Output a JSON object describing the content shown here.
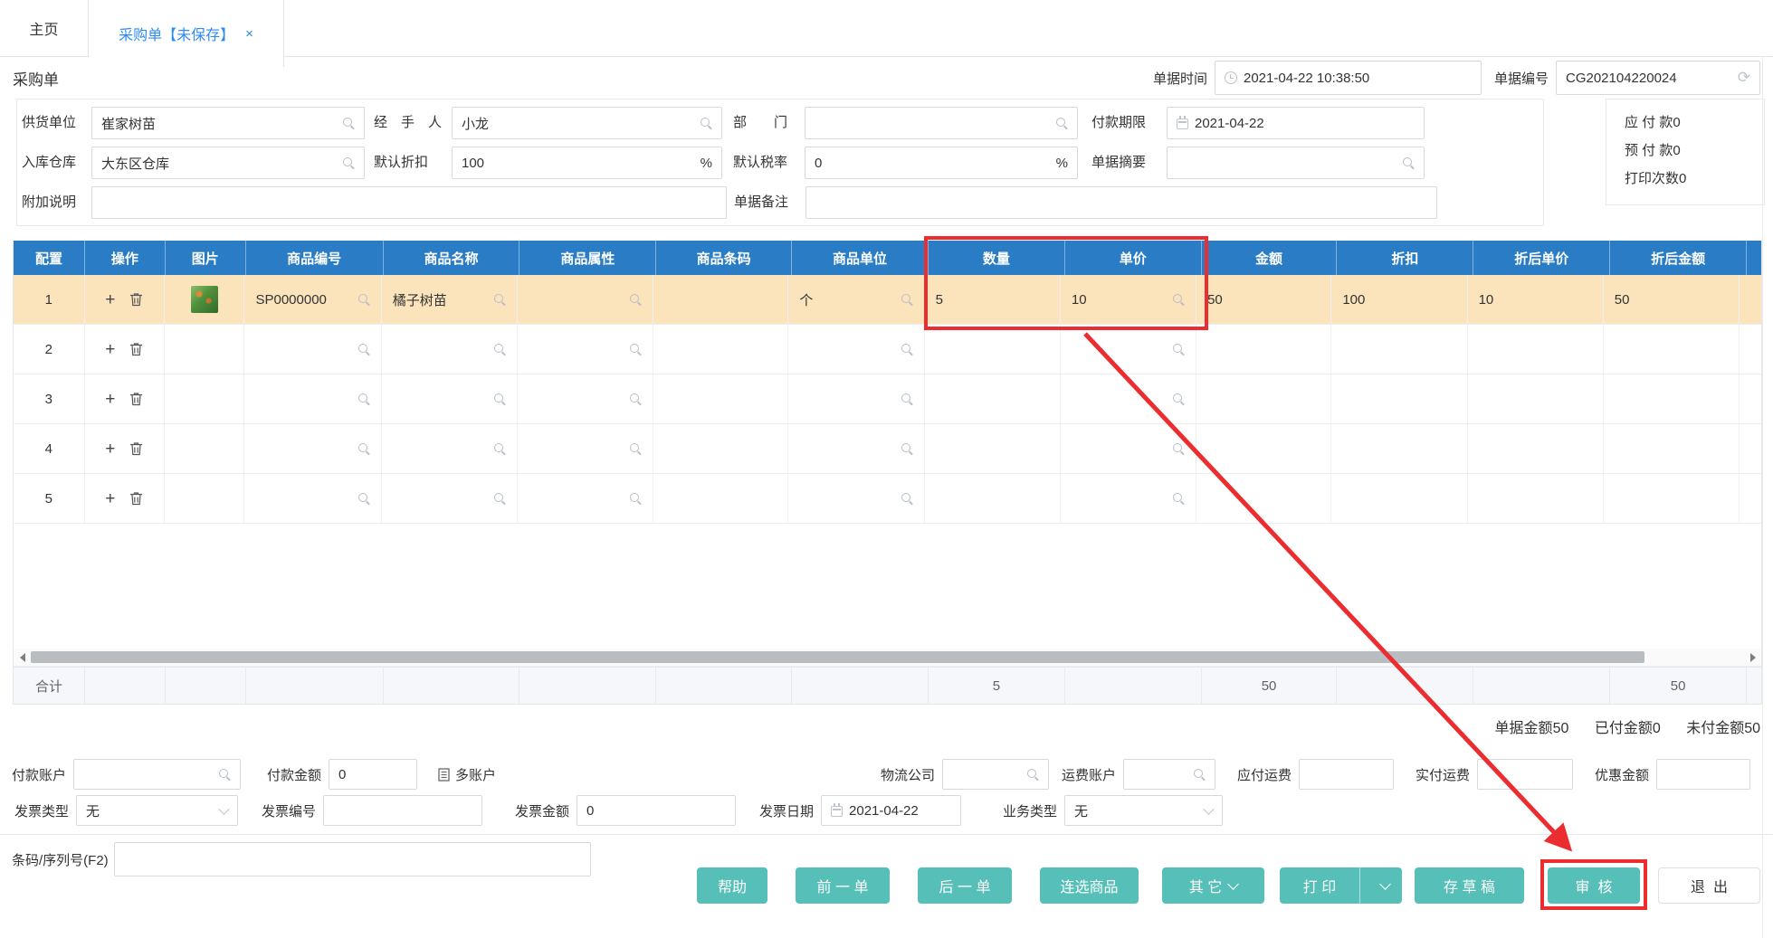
{
  "tabs": {
    "home": "主页",
    "current": "采购单【未保存】"
  },
  "title": "采购单",
  "header_fields": {
    "time_label": "单据时间",
    "time_value": "2021-04-22 10:38:50",
    "no_label": "单据编号",
    "no_value": "CG202104220024"
  },
  "form": {
    "supplier_label": "供货单位",
    "supplier_value": "崔家树苗",
    "handler_label": "经　手　人",
    "handler_value": "小龙",
    "dept_label": "部　　门",
    "dept_value": "",
    "due_label": "付款期限",
    "due_value": "2021-04-22",
    "warehouse_label": "入库仓库",
    "warehouse_value": "大东区仓库",
    "discount_label": "默认折扣",
    "discount_value": "100",
    "discount_suffix": "%",
    "tax_label": "默认税率",
    "tax_value": "0",
    "tax_suffix": "%",
    "summary_label": "单据摘要",
    "summary_value": "",
    "extra_label": "附加说明",
    "extra_value": "",
    "remark_label": "单据备注",
    "remark_value": ""
  },
  "stats": {
    "payable_label": "应 付 款",
    "payable_value": "0",
    "prepaid_label": "预 付 款",
    "prepaid_value": "0",
    "prints_label": "打印次数",
    "prints_value": "0"
  },
  "grid": {
    "headers": [
      "配置",
      "操作",
      "图片",
      "商品编号",
      "商品名称",
      "商品属性",
      "商品条码",
      "商品单位",
      "数量",
      "单价",
      "金额",
      "折扣",
      "折后单价",
      "折后金额"
    ],
    "rows": [
      {
        "no": "1",
        "code": "SP0000000",
        "name": "橘子树苗",
        "attr": "",
        "barcode": "",
        "unit": "个",
        "qty": "5",
        "price": "10",
        "amount": "50",
        "discount": "100",
        "disc_price": "10",
        "disc_amount": "50",
        "has_image": true
      },
      {
        "no": "2"
      },
      {
        "no": "3"
      },
      {
        "no": "4"
      },
      {
        "no": "5"
      }
    ],
    "total_label": "合计",
    "totals": {
      "qty": "5",
      "amount": "50",
      "disc_amount": "50"
    }
  },
  "summary": {
    "doc_amount_label": "单据金额",
    "doc_amount": "50",
    "paid_label": "已付金额",
    "paid": "0",
    "unpaid_label": "未付金额",
    "unpaid": "50"
  },
  "payment": {
    "account_label": "付款账户",
    "account_value": "",
    "amount_label": "付款金额",
    "amount_value": "0",
    "multi_account": "多账户",
    "logistics_label": "物流公司",
    "logistics_value": "",
    "freight_account_label": "运费账户",
    "freight_account_value": "",
    "freight_payable_label": "应付运费",
    "freight_payable_value": "",
    "freight_paid_label": "实付运费",
    "freight_paid_value": "",
    "discount_amount_label": "优惠金额",
    "discount_amount_value": ""
  },
  "invoice": {
    "type_label": "发票类型",
    "type_value": "无",
    "no_label": "发票编号",
    "no_value": "",
    "amount_label": "发票金额",
    "amount_value": "0",
    "date_label": "发票日期",
    "date_value": "2021-04-22",
    "biz_type_label": "业务类型",
    "biz_type_value": "无"
  },
  "barcode": {
    "label": "条码/序列号(F2)",
    "value": ""
  },
  "buttons": {
    "help": "帮助",
    "prev": "前 一 单",
    "next": "后 一 单",
    "multi_select": "连选商品",
    "other": "其 它",
    "print": "打 印",
    "draft": "存 草 稿",
    "audit": "审  核",
    "exit": "退  出"
  },
  "icons": {
    "search": "magnifier",
    "clock": "clock",
    "calendar": "calendar",
    "refresh": "refresh-arrow",
    "plus": "plus",
    "trash": "trash-can",
    "close": "x",
    "chevron": "chevron-down",
    "multi_account": "list-document"
  },
  "colors": {
    "header_blue": "#2a7dc5",
    "row_highlight": "#fbe4bc",
    "accent_teal": "#56bfb8",
    "annotation_red": "#ec2d30",
    "tab_active_blue": "#2d8cf0"
  }
}
